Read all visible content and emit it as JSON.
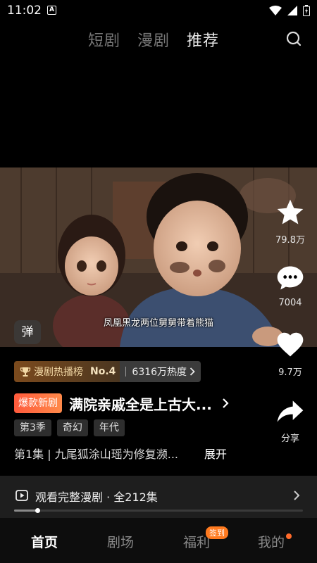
{
  "status_bar": {
    "time": "11:02",
    "a_icon": "A"
  },
  "top_nav": {
    "tabs": [
      "短剧",
      "漫剧",
      "推荐"
    ],
    "active_tab": "推荐"
  },
  "video": {
    "subtitle": "凤凰黑龙两位舅舅带着熊猫",
    "danmu_label": "弹"
  },
  "actions": {
    "collect_count": "79.8万",
    "comment_count": "7004",
    "like_count": "9.7万",
    "share_label": "分享"
  },
  "rank": {
    "label": "漫剧热播榜",
    "number": "No.4",
    "heat": "6316万热度"
  },
  "show": {
    "badge": "爆款新剧",
    "title": "满院亲戚全是上古大...",
    "tags": [
      "第3季",
      "奇幻",
      "年代"
    ],
    "description": "第1集 | 九尾狐涂山瑶为修复濒...",
    "expand_label": "展开"
  },
  "watch_bar": {
    "text": "观看完整漫剧 · 全212集",
    "progress": 0.08
  },
  "bottom_nav": {
    "items": [
      "首页",
      "剧场",
      "福利",
      "我的"
    ],
    "signin_badge": "签到"
  },
  "colors": {
    "accent_orange": "#ff7a1f",
    "badge_red": "#ff5a3c"
  }
}
